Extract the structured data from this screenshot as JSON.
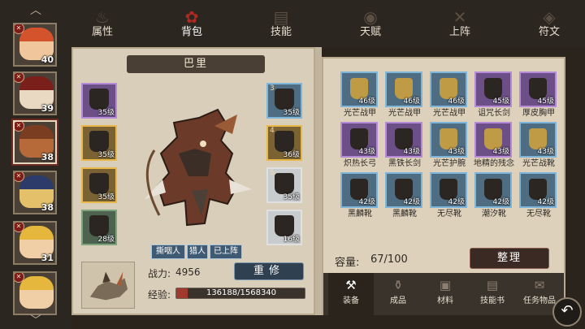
{
  "tabs": [
    {
      "label": "属性",
      "icon": "flame-icon"
    },
    {
      "label": "背包",
      "icon": "rose-icon"
    },
    {
      "label": "技能",
      "icon": "book-icon"
    },
    {
      "label": "天赋",
      "icon": "eye-icon"
    },
    {
      "label": "上阵",
      "icon": "crossed-swords-icon"
    },
    {
      "label": "符文",
      "icon": "rune-icon"
    }
  ],
  "roster": [
    {
      "level": "40",
      "hair": "#d4532c",
      "skin": "#f0c79d"
    },
    {
      "level": "39",
      "hair": "#7a1f1a",
      "skin": "#e9d9c2"
    },
    {
      "level": "38",
      "hair": "#7a3d22",
      "skin": "#b66a3a"
    },
    {
      "level": "38",
      "hair": "#2d3b6b",
      "skin": "#e5c06b"
    },
    {
      "level": "31",
      "hair": "#e6b73d",
      "skin": "#f1cfa6"
    },
    {
      "level": "",
      "hair": "#e6b73d",
      "skin": "#f1cfa6"
    }
  ],
  "hero": {
    "name": "巴里",
    "tags": [
      "撕咽人",
      "猎人",
      "已上阵"
    ],
    "power_label": "战力:",
    "power_value": "4956",
    "rebuild_label": "重修",
    "exp_label": "经验:",
    "exp_text": "136188/1568340",
    "exp_fraction": 0.087
  },
  "equipment": [
    {
      "slot": "",
      "level": "35级",
      "rarity": "purple"
    },
    {
      "slot": "",
      "level": "35级",
      "rarity": "gold"
    },
    {
      "slot": "",
      "level": "35级",
      "rarity": "gold"
    },
    {
      "slot": "",
      "level": "28级",
      "rarity": "green"
    },
    {
      "slot": "3",
      "level": "35级",
      "rarity": "blue"
    },
    {
      "slot": "4",
      "level": "36级",
      "rarity": "gold"
    },
    {
      "slot": "5",
      "level": "35级",
      "rarity": "white"
    },
    {
      "slot": "",
      "level": "16级",
      "rarity": "white"
    }
  ],
  "inventory": {
    "items": [
      {
        "name": "光芒战甲",
        "level": "46级",
        "rarity": "blue",
        "gold": true
      },
      {
        "name": "光芒战甲",
        "level": "46级",
        "rarity": "blue",
        "gold": true
      },
      {
        "name": "光芒战甲",
        "level": "46级",
        "rarity": "blue",
        "gold": true
      },
      {
        "name": "诅咒长剑",
        "level": "45级",
        "rarity": "purple",
        "gold": false
      },
      {
        "name": "厚皮胸甲",
        "level": "45级",
        "rarity": "purple",
        "gold": false
      },
      {
        "name": "炽热长弓",
        "level": "43级",
        "rarity": "purple",
        "gold": false
      },
      {
        "name": "黑铁长剑",
        "level": "43级",
        "rarity": "purple",
        "gold": false
      },
      {
        "name": "光芒护腕",
        "level": "43级",
        "rarity": "blue",
        "gold": true
      },
      {
        "name": "地精的残念",
        "level": "43级",
        "rarity": "purple",
        "gold": true
      },
      {
        "name": "光芒战靴",
        "level": "43级",
        "rarity": "blue",
        "gold": true
      },
      {
        "name": "黑麟靴",
        "level": "42级",
        "rarity": "blue",
        "gold": false
      },
      {
        "name": "黑麟靴",
        "level": "42级",
        "rarity": "blue",
        "gold": false
      },
      {
        "name": "无尽靴",
        "level": "42级",
        "rarity": "blue",
        "gold": false
      },
      {
        "name": "潮汐靴",
        "level": "42级",
        "rarity": "blue",
        "gold": false
      },
      {
        "name": "无尽靴",
        "level": "42级",
        "rarity": "blue",
        "gold": false
      }
    ],
    "capacity_label": "容量:",
    "capacity_value": "67/100",
    "sort_label": "整理"
  },
  "bottom_tabs": [
    {
      "label": "装备",
      "icon": "sword-hammer-icon"
    },
    {
      "label": "成品",
      "icon": "potion-icon"
    },
    {
      "label": "材料",
      "icon": "material-icon"
    },
    {
      "label": "技能书",
      "icon": "skillbook-icon"
    },
    {
      "label": "任务物品",
      "icon": "quest-item-icon"
    }
  ]
}
